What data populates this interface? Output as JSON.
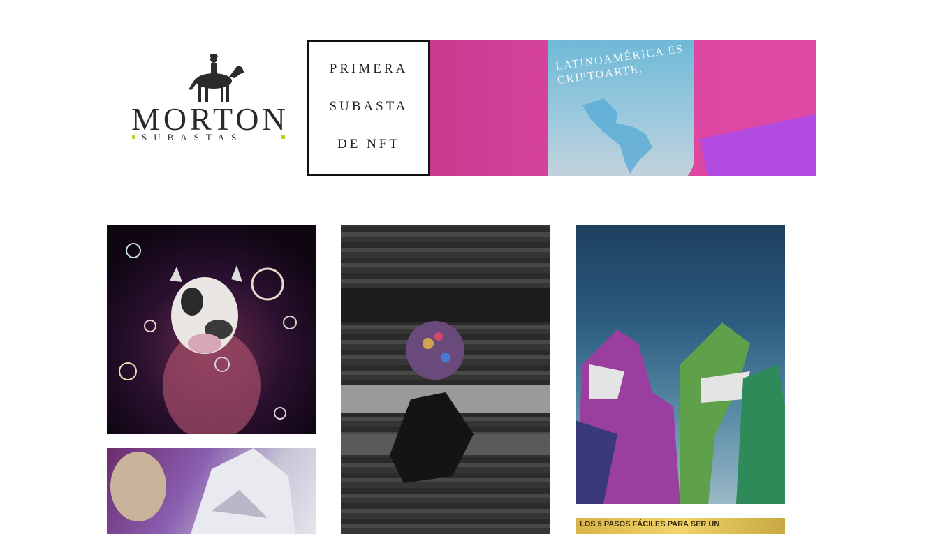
{
  "logo": {
    "name": "MORTON",
    "tagline": "SUBASTAS",
    "accent_color": "#b7d42a",
    "icon": "horse-rider-icon"
  },
  "banner": {
    "lines": [
      "PRIMERA",
      "SUBASTA",
      "DE NFT"
    ],
    "card_text": "LATINOAMÉRICA ES CRIPTOARTE.",
    "pink": "#d8409c",
    "purple": "#b24be0"
  },
  "gallery": {
    "tiles": [
      {
        "label": "nft-artwork-cow-mask"
      },
      {
        "label": "nft-artwork-glitch"
      },
      {
        "label": "nft-artwork-dinosaurs"
      },
      {
        "label": "nft-artwork-sculpture"
      },
      {
        "label": "nft-artwork-pasos",
        "text": "LOS 5 PASOS FÁCILES PARA SER UN"
      }
    ]
  }
}
